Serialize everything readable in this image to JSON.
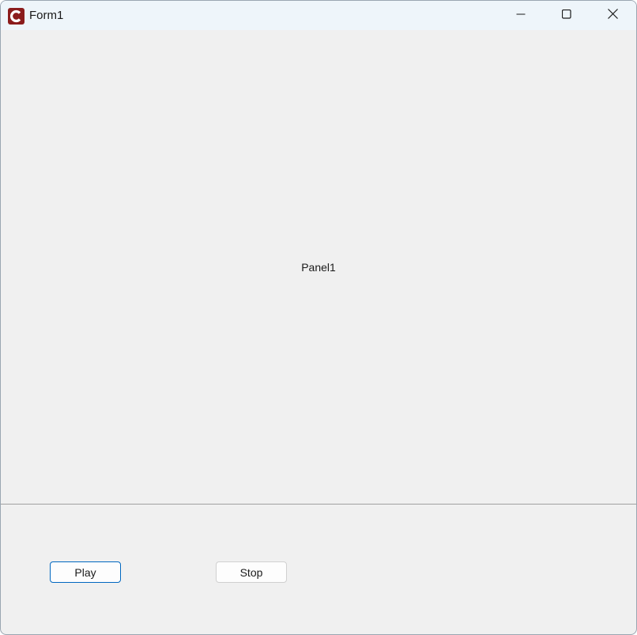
{
  "window": {
    "title": "Form1",
    "icon": "app-c-icon",
    "controls": {
      "minimize": "minimize-icon",
      "maximize": "maximize-icon",
      "close": "close-icon"
    }
  },
  "panel": {
    "caption": "Panel1"
  },
  "buttons": {
    "play_label": "Play",
    "stop_label": "Stop"
  },
  "colors": {
    "titlebar_bg": "#eef5fa",
    "form_bg": "#f0f0f0",
    "focus_border": "#0067c0",
    "app_icon_bg": "#8b1c1c"
  }
}
